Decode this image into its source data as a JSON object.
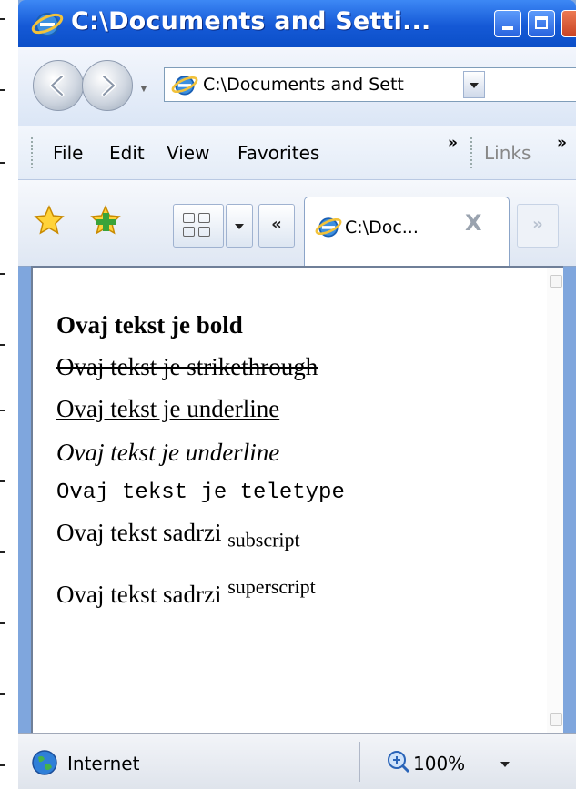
{
  "window": {
    "title": "C:\\Documents and Setti..."
  },
  "nav": {
    "address": "C:\\Documents and Sett"
  },
  "menu": {
    "items": [
      "File",
      "Edit",
      "View",
      "Favorites"
    ],
    "chevron": "»",
    "links_label": "Links",
    "links_chevron": "»"
  },
  "tabs": {
    "scroll_left": "«",
    "scroll_right": "»",
    "active_label": "C:\\Doc...",
    "close_glyph": "X"
  },
  "content": {
    "bold": "Ovaj tekst je bold",
    "strike": "Ovaj tekst je strikethrough",
    "underline": "Ovaj tekst je underline",
    "italic": "Ovaj tekst je underline",
    "teletype": "Ovaj tekst je teletype",
    "sub_prefix": "Ovaj tekst sadrzi",
    "sub_text": "subscript",
    "sup_prefix": "Ovaj tekst sadrzi",
    "sup_text": "superscript"
  },
  "status": {
    "zone": "Internet",
    "zoom": "100%"
  },
  "colors": {
    "titlebar": "#1559d6",
    "close_button": "#c94324",
    "window_frame": "#7fa6dd"
  },
  "icons": [
    "ie-logo-icon",
    "back-arrow-icon",
    "forward-arrow-icon",
    "favorites-star-icon",
    "add-favorite-icon",
    "quick-tabs-icon",
    "globe-icon",
    "zoom-icon"
  ]
}
